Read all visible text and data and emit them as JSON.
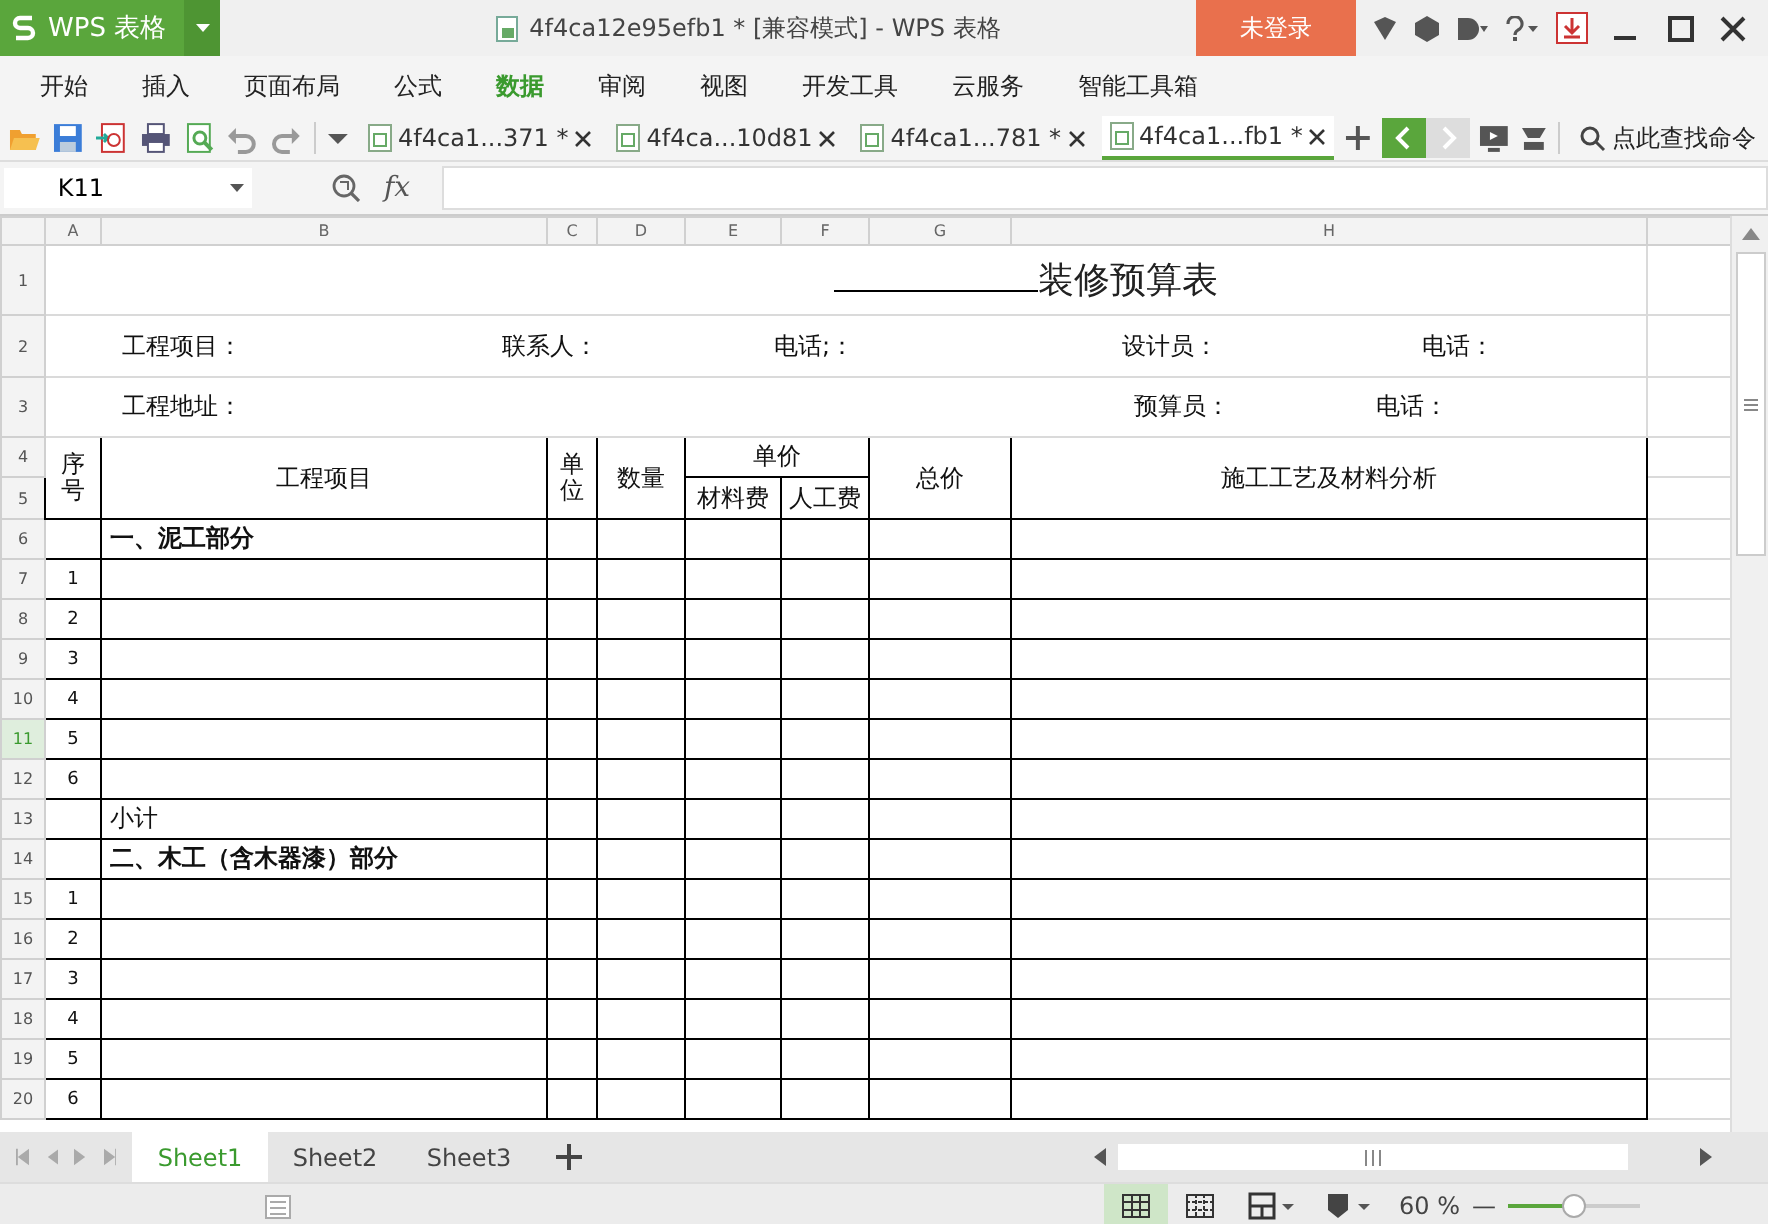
{
  "app": {
    "logo": "WPS 表格",
    "title": "4f4ca12e95efb1 * [兼容模式] - WPS 表格",
    "login": "未登录"
  },
  "menu": [
    {
      "label": "开始",
      "selected": false
    },
    {
      "label": "插入",
      "selected": false
    },
    {
      "label": "页面布局",
      "selected": false
    },
    {
      "label": "公式",
      "selected": false
    },
    {
      "label": "数据",
      "selected": true
    },
    {
      "label": "审阅",
      "selected": false
    },
    {
      "label": "视图",
      "selected": false
    },
    {
      "label": "开发工具",
      "selected": false
    },
    {
      "label": "云服务",
      "selected": false
    },
    {
      "label": "智能工具箱",
      "selected": false
    }
  ],
  "doc_tabs": [
    {
      "label": "4f4ca1...371 *",
      "selected": false
    },
    {
      "label": "4f4ca...10d81",
      "selected": false
    },
    {
      "label": "4f4ca1...781 *",
      "selected": false
    },
    {
      "label": "4f4ca1...fb1 *",
      "selected": true
    }
  ],
  "search_command": "点此查找命令",
  "formula_bar": {
    "name_box": "K11",
    "fx": "fx"
  },
  "columns": [
    "A",
    "B",
    "C",
    "D",
    "E",
    "F",
    "G",
    "H"
  ],
  "rows": [
    {
      "label": "1",
      "selected": false
    },
    {
      "label": "2",
      "selected": false
    },
    {
      "label": "3",
      "selected": false
    },
    {
      "label": "4",
      "selected": false
    },
    {
      "label": "5",
      "selected": false
    },
    {
      "label": "6",
      "selected": false
    },
    {
      "label": "7",
      "selected": false
    },
    {
      "label": "8",
      "selected": false
    },
    {
      "label": "9",
      "selected": false
    },
    {
      "label": "10",
      "selected": false
    },
    {
      "label": "11",
      "selected": true
    },
    {
      "label": "12",
      "selected": false
    },
    {
      "label": "13",
      "selected": false
    },
    {
      "label": "14",
      "selected": false
    },
    {
      "label": "15",
      "selected": false
    },
    {
      "label": "16",
      "selected": false
    },
    {
      "label": "17",
      "selected": false
    },
    {
      "label": "18",
      "selected": false
    },
    {
      "label": "19",
      "selected": false
    },
    {
      "label": "20",
      "selected": false
    }
  ],
  "sheet": {
    "title": "装修预算表",
    "info_row_1": [
      "工程项目：",
      "联系人：",
      "电话;：",
      "设计员：",
      "电话："
    ],
    "info_row_2": [
      "工程地址：",
      "预算员：",
      "电话："
    ],
    "header": {
      "no": "序号",
      "item": "工程项目",
      "unit": "单位",
      "qty": "数量",
      "unit_price": "单价",
      "material": "材料费",
      "labor": "人工费",
      "total": "总价",
      "analysis": "施工工艺及材料分析"
    },
    "body": [
      {
        "kind": "section",
        "text": "一、泥工部分"
      },
      {
        "kind": "item",
        "text": "1"
      },
      {
        "kind": "item",
        "text": "2"
      },
      {
        "kind": "item",
        "text": "3"
      },
      {
        "kind": "item",
        "text": "4"
      },
      {
        "kind": "item",
        "text": "5"
      },
      {
        "kind": "item",
        "text": "6"
      },
      {
        "kind": "subtotal",
        "text": "小计"
      },
      {
        "kind": "section",
        "text": "二、木工（含木器漆）部分"
      },
      {
        "kind": "item",
        "text": "1"
      },
      {
        "kind": "item",
        "text": "2"
      },
      {
        "kind": "item",
        "text": "3"
      },
      {
        "kind": "item",
        "text": "4"
      },
      {
        "kind": "item",
        "text": "5"
      },
      {
        "kind": "item",
        "text": "6"
      }
    ]
  },
  "sheet_tabs": [
    {
      "label": "Sheet1",
      "selected": true
    },
    {
      "label": "Sheet2",
      "selected": false
    },
    {
      "label": "Sheet3",
      "selected": false
    }
  ],
  "status_bar": {
    "zoom": "60 %",
    "zoom_out": "—",
    "level": 0.5
  }
}
